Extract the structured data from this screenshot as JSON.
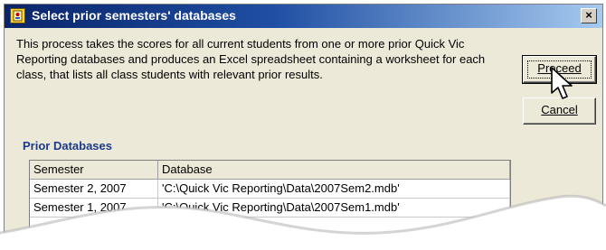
{
  "window": {
    "title": "Select prior semesters' databases",
    "close_glyph": "×"
  },
  "description": "This process takes the scores for all current students from one or more prior Quick Vic Reporting databases and produces an Excel spreadsheet containing a worksheet for each class, that lists all class students with relevant prior results.",
  "buttons": {
    "proceed_label": "Proceed",
    "cancel_label": "Cancel"
  },
  "group": {
    "label": "Prior Databases"
  },
  "table": {
    "headers": [
      "Semester",
      "Database"
    ],
    "rows": [
      [
        "Semester 2, 2007",
        "'C:\\Quick Vic Reporting\\Data\\2007Sem2.mdb'"
      ],
      [
        "Semester 1, 2007",
        "'C:\\Quick Vic Reporting\\Data\\2007Sem1.mdb'"
      ]
    ]
  },
  "icons": {
    "title_icon": "database-app-icon",
    "cursor": "mouse-pointer-icon"
  },
  "colors": {
    "title_start": "#0a246a",
    "title_end": "#a6caf0",
    "group_label": "#1c3a8a",
    "dialog_bg": "#ece9d8"
  }
}
